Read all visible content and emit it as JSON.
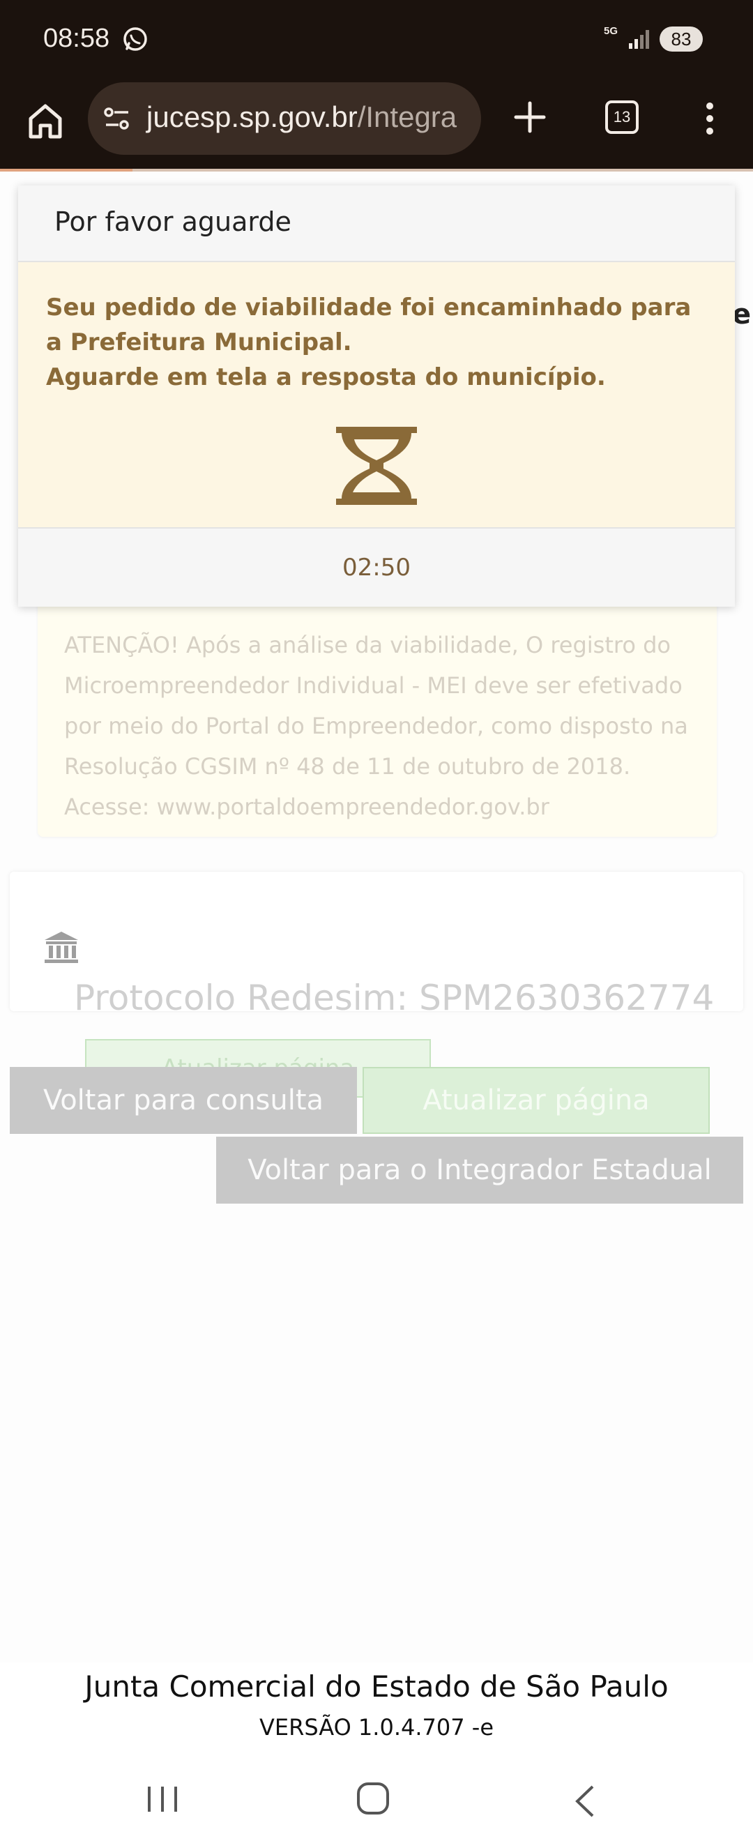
{
  "status_bar": {
    "time": "08:58",
    "network": "5G",
    "battery": "83"
  },
  "browser": {
    "url_domain": "jucesp.sp.gov.br",
    "url_path": "/Integra",
    "tab_count": "13"
  },
  "modal": {
    "title": "Por favor aguarde",
    "message_line1": "Seu pedido de viabilidade foi encaminhado para a Prefeitura Municipal.",
    "message_line2": "Aguarde em tela a resposta do município.",
    "timer": "02:50"
  },
  "page": {
    "alert_text": "ATENÇÃO! Após a análise da viabilidade, O registro do Microempreendedor Individual - MEI deve ser efetivado por meio do Portal do Empreendedor, como disposto na Resolução CGSIM nº 48 de 11 de outubro de 2018. Acesse: www.portaldoempreendedor.gov.br",
    "protocolo": "Protocolo Redesim: SPM2630362774",
    "btn_atualizar_behind": "Atualizar página",
    "btn_voltar_consulta": "Voltar para consulta",
    "btn_atualizar": "Atualizar página",
    "btn_voltar_integrador": "Voltar para o Integrador Estadual"
  },
  "footer": {
    "org": "Junta Comercial do Estado de São Paulo",
    "version": "VERSÃO 1.0.4.707 -e"
  },
  "colors": {
    "browser_bg": "#1b120d",
    "modal_body_bg": "#fdf6e3",
    "modal_text": "#8a6a38",
    "hourglass": "#8a6a38"
  }
}
